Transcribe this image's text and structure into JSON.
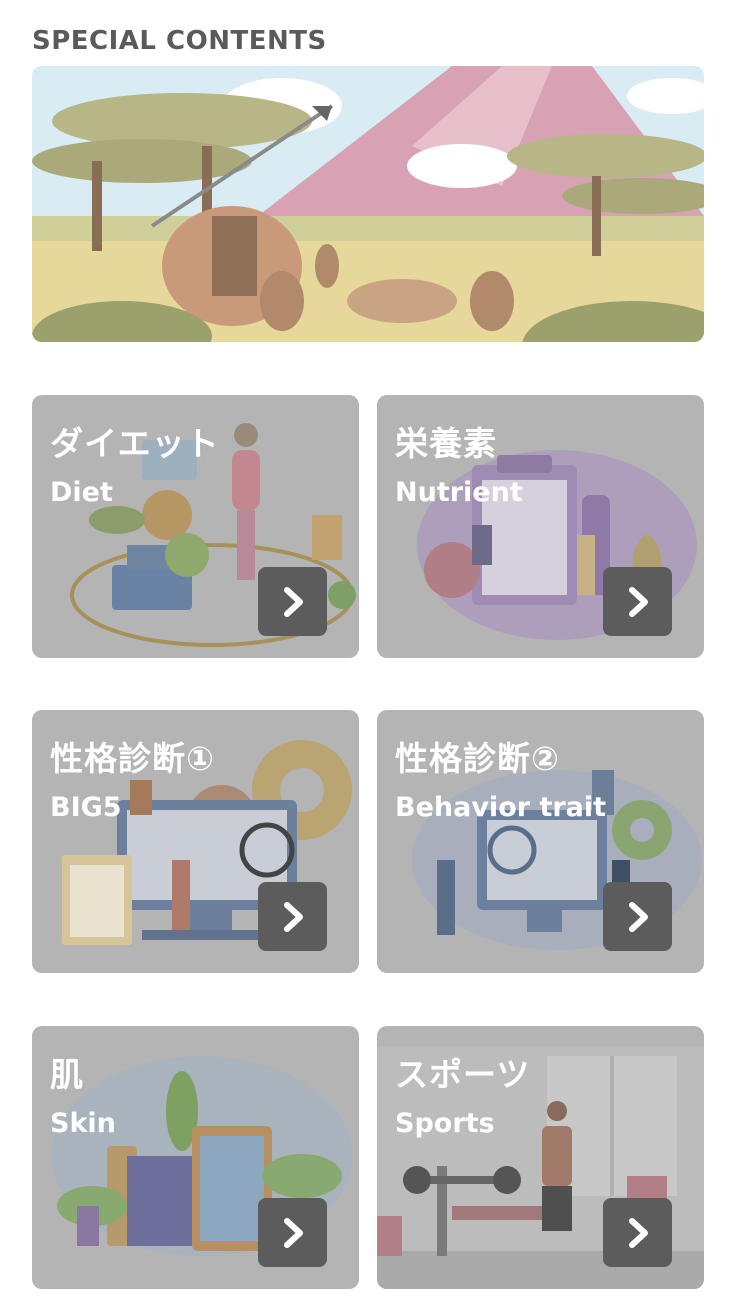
{
  "section": {
    "title": "SPECIAL CONTENTS"
  },
  "banner": {
    "icon": "savanna-hunting-illustration"
  },
  "cards": [
    {
      "jp": "ダイエット",
      "en": "Diet",
      "icon": "diet-illustration"
    },
    {
      "jp": "栄養素",
      "en": "Nutrient",
      "icon": "nutrient-illustration"
    },
    {
      "jp": "性格診断①",
      "en": "BIG5",
      "icon": "personality-test-illustration"
    },
    {
      "jp": "性格診断②",
      "en": "Behavior trait",
      "icon": "behavior-analysis-illustration"
    },
    {
      "jp": "肌",
      "en": "Skin",
      "icon": "skin-illustration"
    },
    {
      "jp": "スポーツ",
      "en": "Sports",
      "icon": "gym-illustration"
    }
  ],
  "colors": {
    "card_overlay": "#b4b4b4",
    "arrow_button": "#5c5c5c",
    "title": "#5a5a5a"
  }
}
